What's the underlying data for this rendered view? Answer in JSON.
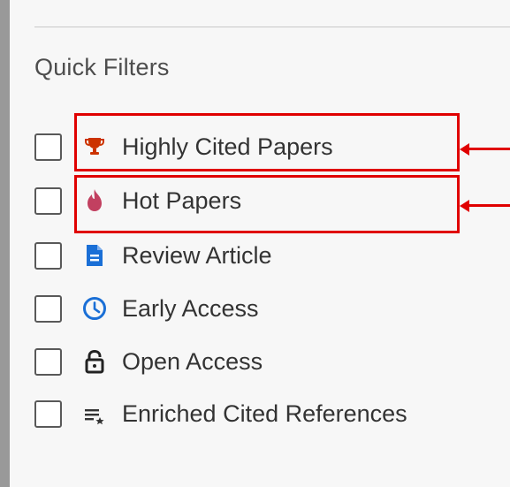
{
  "section": {
    "title": "Quick Filters"
  },
  "filters": [
    {
      "label": "Highly Cited Papers",
      "icon": "trophy-icon",
      "checked": false,
      "icon_color": "#cc3300"
    },
    {
      "label": "Hot Papers",
      "icon": "flame-icon",
      "checked": false,
      "icon_color": "#c24060"
    },
    {
      "label": "Review Article",
      "icon": "document-icon",
      "checked": false,
      "icon_color": "#1a6fd6"
    },
    {
      "label": "Early Access",
      "icon": "clock-icon",
      "checked": false,
      "icon_color": "#1a6fd6"
    },
    {
      "label": "Open Access",
      "icon": "unlock-icon",
      "checked": false,
      "icon_color": "#222222"
    },
    {
      "label": "Enriched Cited References",
      "icon": "list-star-icon",
      "checked": false,
      "icon_color": "#333333"
    }
  ],
  "annotations": {
    "highlight_color": "#e00000"
  }
}
